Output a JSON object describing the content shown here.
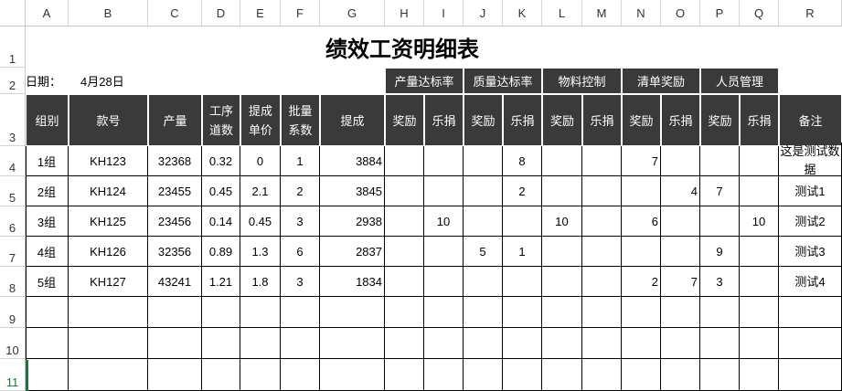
{
  "columns": [
    "A",
    "B",
    "C",
    "D",
    "E",
    "F",
    "G",
    "H",
    "I",
    "J",
    "K",
    "L",
    "M",
    "N",
    "O",
    "P",
    "Q",
    "R"
  ],
  "rows": [
    "1",
    "2",
    "3",
    "4",
    "5",
    "6",
    "7",
    "8",
    "9",
    "10",
    "11"
  ],
  "title": "绩效工资明细表",
  "date_label": "日期：",
  "date_value": "4月28日",
  "groups": [
    "产量达标率",
    "质量达标率",
    "物料控制",
    "清单奖励",
    "人员管理"
  ],
  "headers": {
    "group": "组别",
    "style": "款号",
    "output": "产量",
    "process_count": [
      "工序",
      "道数"
    ],
    "unit_price": [
      "提成",
      "单价"
    ],
    "batch_coef": [
      "批量",
      "系数"
    ],
    "commission": "提成",
    "reward": "奖励",
    "donation": "乐捐",
    "remark": "备注"
  },
  "data_rows": [
    {
      "group": "1组",
      "style": "KH123",
      "output": "32368",
      "process": "0.32",
      "price": "0",
      "coef": "1",
      "commission": "3884",
      "sub": [
        "",
        "",
        "",
        "8",
        "",
        "",
        "7",
        "",
        "",
        ""
      ],
      "remark": "这是测试数据"
    },
    {
      "group": "2组",
      "style": "KH124",
      "output": "23455",
      "process": "0.45",
      "price": "2.1",
      "coef": "2",
      "commission": "3845",
      "sub": [
        "",
        "",
        "",
        "2",
        "",
        "",
        "",
        "4",
        "7",
        ""
      ],
      "remark": "测试1"
    },
    {
      "group": "3组",
      "style": "KH125",
      "output": "23456",
      "process": "0.14",
      "price": "0.45",
      "coef": "3",
      "commission": "2938",
      "sub": [
        "",
        "10",
        "",
        "",
        "10",
        "",
        "6",
        "",
        "",
        "10"
      ],
      "remark": "测试2"
    },
    {
      "group": "4组",
      "style": "KH126",
      "output": "32356",
      "process": "0.89",
      "price": "1.3",
      "coef": "6",
      "commission": "2837",
      "sub": [
        "",
        "",
        "5",
        "1",
        "",
        "",
        "",
        "",
        "9",
        ""
      ],
      "remark": "测试3"
    },
    {
      "group": "5组",
      "style": "KH127",
      "output": "43241",
      "process": "1.21",
      "price": "1.8",
      "coef": "3",
      "commission": "1834",
      "sub": [
        "",
        "",
        "",
        "",
        "",
        "",
        "2",
        "7",
        "3",
        ""
      ],
      "remark": "测试4"
    }
  ]
}
